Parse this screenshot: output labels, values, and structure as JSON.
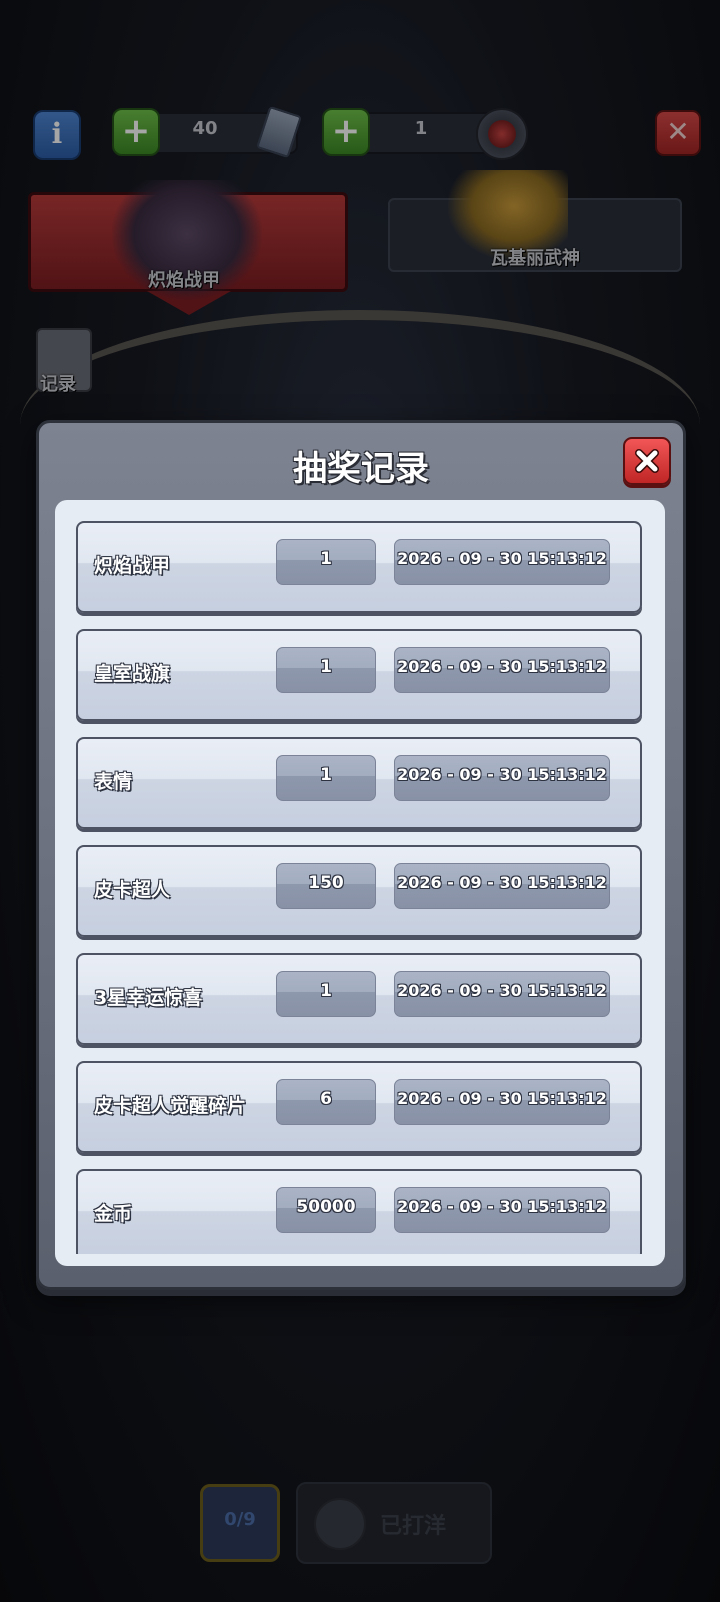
{
  "background": {
    "resource_tickets": "40",
    "resource_tokens": "1",
    "tab_left_label": "炽焰战甲",
    "tab_right_label": "瓦基丽武神",
    "side_record_label": "记录",
    "bottom_counter": "0/9",
    "bottom_claimed_label": "已打洋"
  },
  "modal": {
    "title": "抽奖记录",
    "records": [
      {
        "name": "炽焰战甲",
        "qty": "1",
        "time": "2026 - 09 - 30  15:13:12"
      },
      {
        "name": "皇室战旗",
        "qty": "1",
        "time": "2026 - 09 - 30  15:13:12"
      },
      {
        "name": "表情",
        "qty": "1",
        "time": "2026 - 09 - 30  15:13:12"
      },
      {
        "name": "皮卡超人",
        "qty": "150",
        "time": "2026 - 09 - 30  15:13:12"
      },
      {
        "name": "3星幸运惊喜",
        "qty": "1",
        "time": "2026 - 09 - 30  15:13:12"
      },
      {
        "name": "皮卡超人觉醒碎片",
        "qty": "6",
        "time": "2026 - 09 - 30  15:13:12"
      },
      {
        "name": "金币",
        "qty": "50000",
        "time": "2026 - 09 - 30  15:13:12"
      }
    ]
  },
  "colors": {
    "close_red": "#e23b3b",
    "panel_bg": "#e6ecf3",
    "modal_frame": "#6b717e"
  },
  "icons": {
    "info": "info-icon",
    "plus": "plus-icon",
    "ticket": "ticket-icon",
    "token": "token-icon",
    "close": "close-icon"
  }
}
